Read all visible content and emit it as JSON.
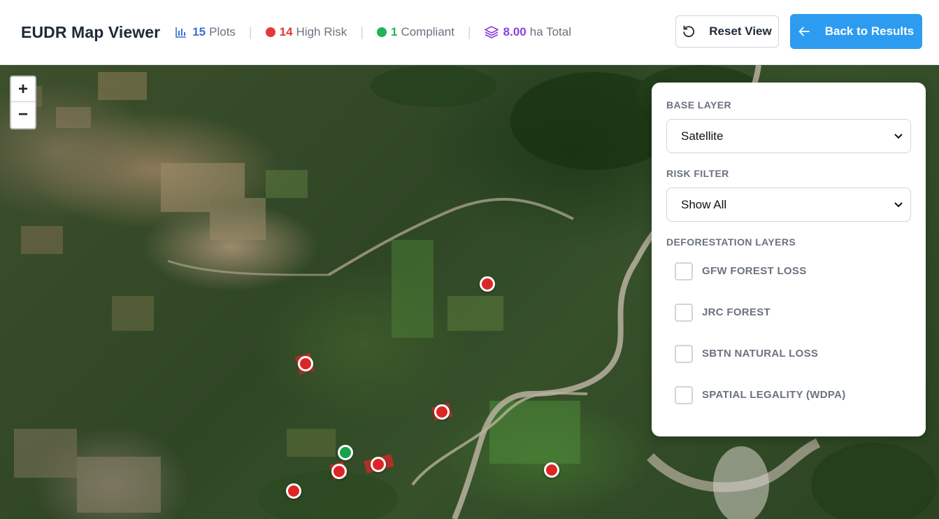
{
  "header": {
    "title": "EUDR Map Viewer",
    "stats": {
      "plots_count": "15",
      "plots_label": "Plots",
      "high_risk_count": "14",
      "high_risk_label": "High Risk",
      "compliant_count": "1",
      "compliant_label": "Compliant",
      "area_value": "8.00",
      "area_label": "ha Total"
    },
    "separator": "|",
    "reset_label": "Reset View",
    "back_label": "Back to Results"
  },
  "colors": {
    "plots": "#3b6fd1",
    "high_risk": "#e53935",
    "compliant": "#22b35a",
    "area": "#8b3fe0",
    "primary_button": "#2d9cf0"
  },
  "map": {
    "zoom_in": "+",
    "zoom_out": "−",
    "icons": [
      "bar-chart-icon",
      "layers-icon",
      "reset-icon",
      "arrow-left-icon",
      "chevron-down-icon"
    ]
  },
  "panel": {
    "base_layer_label": "BASE LAYER",
    "base_layer_value": "Satellite",
    "risk_filter_label": "RISK FILTER",
    "risk_filter_value": "Show All",
    "deforestation_label": "DEFORESTATION LAYERS",
    "layers": [
      {
        "label": "GFW FOREST LOSS",
        "checked": false
      },
      {
        "label": "JRC FOREST",
        "checked": false
      },
      {
        "label": "SBTN NATURAL LOSS",
        "checked": false
      },
      {
        "label": "SPATIAL LEGALITY (WDPA)",
        "checked": false
      }
    ]
  }
}
